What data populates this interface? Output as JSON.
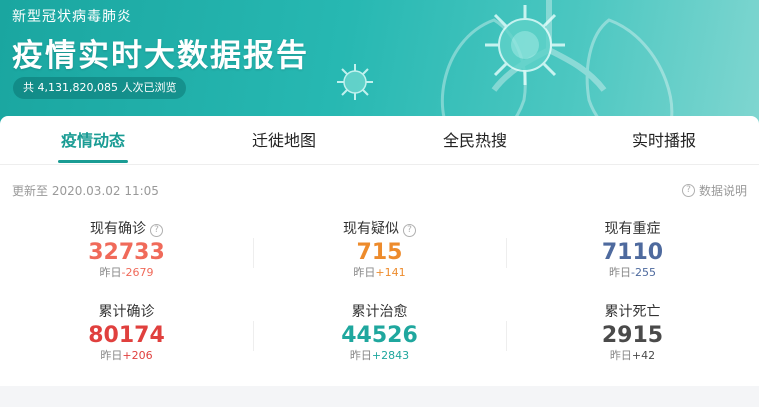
{
  "banner": {
    "subtitle": "新型冠状病毒肺炎",
    "title": "疫情实时大数据报告",
    "views": "共 4,131,820,085 人次已浏览"
  },
  "tabs": [
    {
      "label": "疫情动态",
      "active": true
    },
    {
      "label": "迁徙地图",
      "active": false
    },
    {
      "label": "全民热搜",
      "active": false
    },
    {
      "label": "实时播报",
      "active": false
    }
  ],
  "update_time": "更新至 2020.03.02 11:05",
  "help_label": "数据说明",
  "stats": [
    {
      "label": "现有确诊",
      "value": "32733",
      "delta_prefix": "昨日",
      "delta": "-2679",
      "color": "#f06a5a",
      "has_help": true
    },
    {
      "label": "现有疑似",
      "value": "715",
      "delta_prefix": "昨日",
      "delta": "+141",
      "color": "#ed8b2c",
      "has_help": true
    },
    {
      "label": "现有重症",
      "value": "7110",
      "delta_prefix": "昨日",
      "delta": "-255",
      "color": "#4e6a9e",
      "has_help": false
    },
    {
      "label": "累计确诊",
      "value": "80174",
      "delta_prefix": "昨日",
      "delta": "+206",
      "color": "#e0403e",
      "has_help": false
    },
    {
      "label": "累计治愈",
      "value": "44526",
      "delta_prefix": "昨日",
      "delta": "+2843",
      "color": "#1fa79e",
      "has_help": false
    },
    {
      "label": "累计死亡",
      "value": "2915",
      "delta_prefix": "昨日",
      "delta": "+42",
      "color": "#4a4a4a",
      "has_help": false
    }
  ]
}
